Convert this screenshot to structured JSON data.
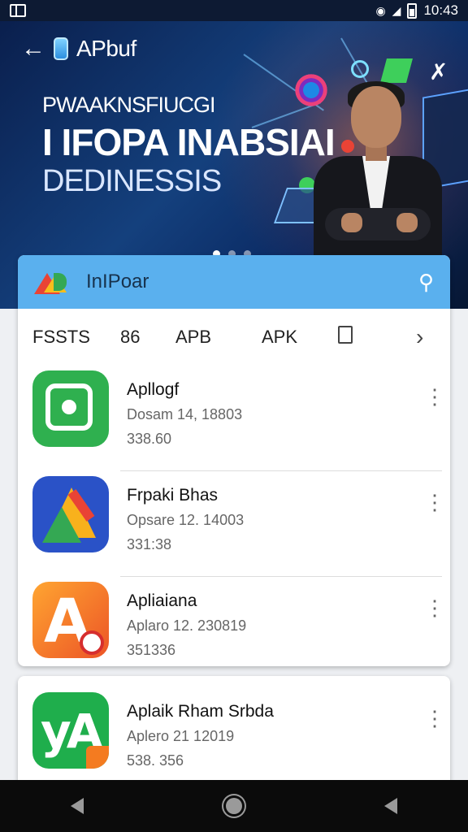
{
  "status_bar": {
    "time": "10:43"
  },
  "banner": {
    "app_name": "APbuf",
    "headline_line1": "PWAAKNSFIUCGI",
    "headline_line2": "I IFOPA INABSIAI",
    "headline_line3": "DEDINESSIS",
    "carousel_dots": 3,
    "active_dot": 0
  },
  "toolbar": {
    "title": "InIPoar"
  },
  "tabs": [
    {
      "label": "FSSTS"
    },
    {
      "label": "86"
    },
    {
      "label": "APB"
    },
    {
      "label": "APK"
    }
  ],
  "apps": [
    {
      "name": "Apllogf",
      "date": "Dosam 14, 18803",
      "size": "338.60",
      "icon": "green-square-icon"
    },
    {
      "name": "Frpaki Bhas",
      "date": "Opsare 12. 14003",
      "size": "331:38",
      "icon": "blue-triangle-icon"
    },
    {
      "name": "Apliaiana",
      "date": "Aplaro 12. 230819",
      "size": "351336",
      "icon": "orange-a-icon"
    },
    {
      "name": "Aplaik Rham Srbda",
      "date": "Aplero 21 12019",
      "size": "538. 356",
      "icon": "green-ya-icon"
    }
  ],
  "colors": {
    "toolbar_bg": "#5ab0ee",
    "banner_bg": "#0b2a63",
    "navbar_bg": "#0b0b0b"
  }
}
